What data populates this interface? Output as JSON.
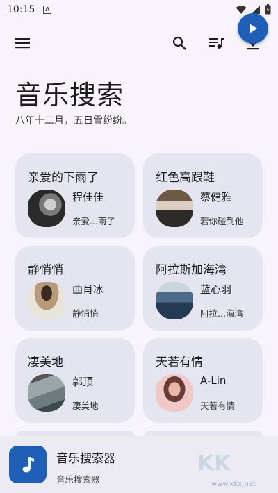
{
  "status_bar": {
    "time": "10:15",
    "notification_letter": "A"
  },
  "page": {
    "title": "音乐搜索",
    "subtitle": "八年十二月，五日雪纷纷。"
  },
  "cards": [
    {
      "title": "亲爱的下雨了",
      "artist": "程佳佳",
      "song": "亲爱...雨了"
    },
    {
      "title": "红色高跟鞋",
      "artist": "蔡健雅",
      "song": "若你碰到他"
    },
    {
      "title": "静悄悄",
      "artist": "曲肖冰",
      "song": "静悄悄"
    },
    {
      "title": "阿拉斯加海湾",
      "artist": "蓝心羽",
      "song": "阿拉...海湾"
    },
    {
      "title": "凄美地",
      "artist": "郭顶",
      "song": "凄美地"
    },
    {
      "title": "天若有情",
      "artist": "A-Lin",
      "song": "天若有情"
    }
  ],
  "player": {
    "title": "音乐搜索器",
    "subtitle": "音乐搜索器"
  },
  "watermark": {
    "text": "KK",
    "url": "www.kkx.net"
  },
  "colors": {
    "background": "#f7f5fb",
    "card": "#e5e5ef",
    "accent": "#1f5fb8"
  },
  "icons": [
    "menu-icon",
    "search-icon",
    "queue-music-icon",
    "download-icon",
    "music-note-icon",
    "play-icon"
  ]
}
